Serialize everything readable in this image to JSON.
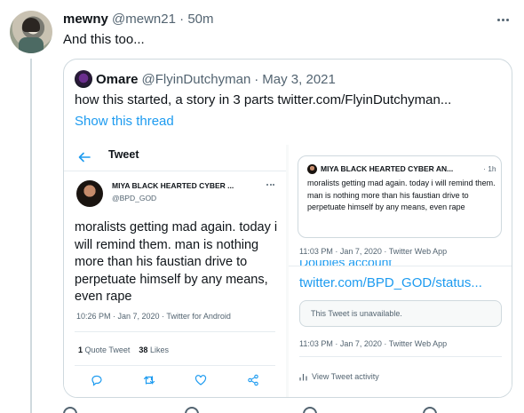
{
  "tweet": {
    "name": "mewny",
    "handle": "@mewn21",
    "separator": "·",
    "time": "50m",
    "text": "And this too..."
  },
  "quote": {
    "name": "Omare",
    "handle": "@FlyinDutchyman",
    "separator": "·",
    "date": "May 3, 2021",
    "text": "how this started, a story in 3 parts  twitter.com/FlyinDutchyman...",
    "show_thread": "Show this thread"
  },
  "screenshot_left": {
    "header": "Tweet",
    "author_name": "MIYA BLACK HEARTED CYBER ...",
    "author_handle": "@BPD_GOD",
    "text": "moralists getting mad again. today i will remind them. man is nothing more than his faustian drive to perpetuate himself by any means, even rape",
    "meta": "10:26 PM · Jan 7, 2020 · Twitter for Android",
    "quote_count": "1",
    "quote_label": "Quote Tweet",
    "likes_count": "38",
    "likes_label": "Likes"
  },
  "screenshot_right": {
    "card_name": "MIYA BLACK HEARTED CYBER AN...",
    "card_time": "· 1h",
    "card_text": "moralists getting mad again. today i will remind them. man is nothing more than his faustian drive to perpetuate himself by any means, even rape",
    "meta1": "11:03 PM · Jan 7, 2020 · Twitter Web App",
    "cut_text": "Doubles account",
    "link": "twitter.com/BPD_GOD/status...",
    "unavailable": "This Tweet is unavailable.",
    "meta2": "11:03 PM · Jan 7, 2020 · Twitter Web App",
    "activity": "View Tweet activity"
  },
  "colors": {
    "accent": "#1d9bf0",
    "muted": "#536471",
    "border": "#cfd9de"
  },
  "icons": [
    "more-icon",
    "back-arrow-icon",
    "reply-icon",
    "retweet-icon",
    "like-icon",
    "share-icon",
    "activity-icon"
  ]
}
